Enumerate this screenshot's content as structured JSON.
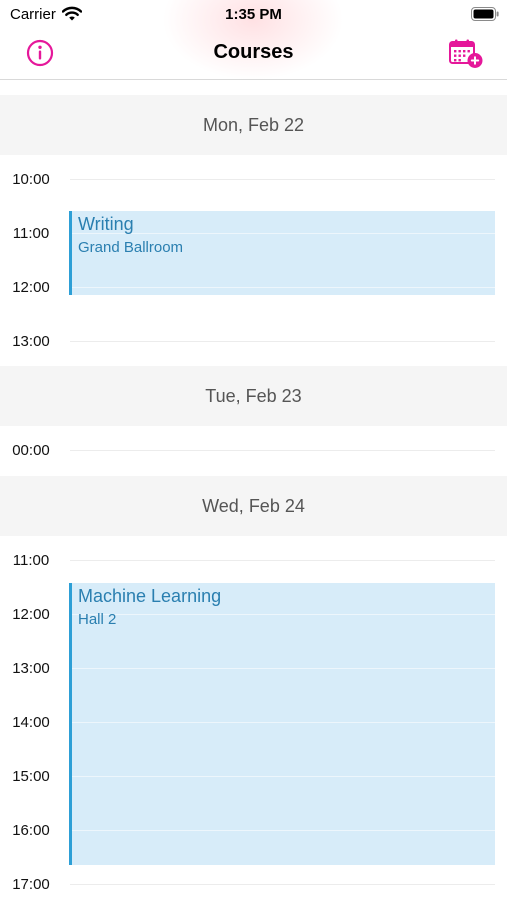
{
  "status_bar": {
    "carrier": "Carrier",
    "time": "1:35 PM"
  },
  "nav": {
    "title": "Courses",
    "left_icon": "info-icon",
    "right_icon": "calendar-add-icon",
    "accent": "#e5179a"
  },
  "days": [
    {
      "label": "Mon, Feb 22",
      "hours": [
        "10:00",
        "11:00",
        "12:00",
        "13:00"
      ]
    },
    {
      "label": "Tue, Feb 23",
      "hours": [
        "00:00"
      ]
    },
    {
      "label": "Wed, Feb 24",
      "hours": [
        "11:00",
        "12:00",
        "13:00",
        "14:00",
        "15:00",
        "16:00",
        "17:00"
      ]
    }
  ],
  "events": [
    {
      "title": "Writing",
      "room": "Grand Ballroom",
      "color": "#2d9fd6"
    },
    {
      "title": "Machine Learning",
      "room": "Hall 2",
      "color": "#2d9fd6"
    }
  ]
}
